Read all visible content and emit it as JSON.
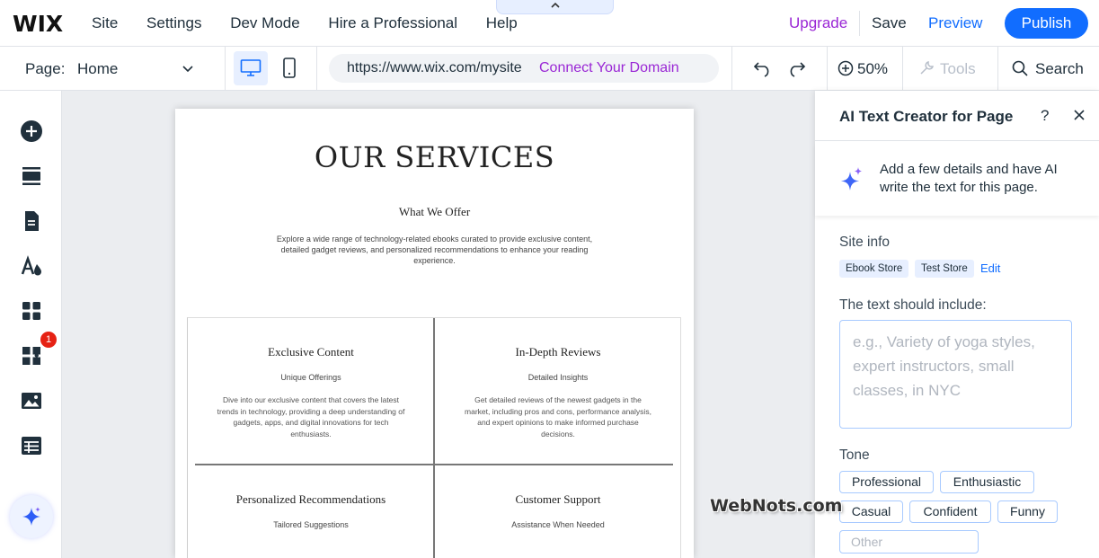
{
  "topbar": {
    "logo": "WIX",
    "nav": [
      "Site",
      "Settings",
      "Dev Mode",
      "Hire a Professional",
      "Help"
    ],
    "upgrade": "Upgrade",
    "save": "Save",
    "preview": "Preview",
    "publish": "Publish",
    "collapse_icon": "chevron-up-icon"
  },
  "secondbar": {
    "page_label": "Page:",
    "page_value": "Home",
    "url": "https://www.wix.com/mysite",
    "connect_domain": "Connect Your Domain",
    "zoom": "50%",
    "tools": "Tools",
    "search": "Search"
  },
  "sidebar": {
    "icons": [
      "add-elements-icon",
      "sections-icon",
      "pages-icon",
      "design-icon",
      "apps-icon",
      "business-apps-icon",
      "media-icon",
      "cms-icon",
      "ai-assistant-icon"
    ],
    "badge": "1"
  },
  "canvas": {
    "title": "OUR SERVICES",
    "subtitle": "What We Offer",
    "description": "Explore a wide range of technology-related ebooks curated to provide exclusive content, detailed gadget reviews, and personalized recommendations to enhance your reading experience.",
    "cells": [
      {
        "title": "Exclusive Content",
        "sub": "Unique Offerings",
        "desc": "Dive into our exclusive content that covers the latest trends in technology, providing a deep understanding of gadgets, apps, and digital innovations for tech enthusiasts."
      },
      {
        "title": "In-Depth Reviews",
        "sub": "Detailed Insights",
        "desc": "Get detailed reviews of the newest gadgets in the market, including pros and cons, performance analysis, and expert opinions to make informed purchase decisions."
      },
      {
        "title": "Personalized Recommendations",
        "sub": "Tailored Suggestions",
        "desc": ""
      },
      {
        "title": "Customer Support",
        "sub": "Assistance When Needed",
        "desc": ""
      }
    ]
  },
  "panel": {
    "title": "AI Text Creator for Page",
    "help": "?",
    "intro": "Add a few details and have AI write the text for this page.",
    "site_info_label": "Site info",
    "chips": [
      "Ebook Store",
      "Test Store"
    ],
    "edit": "Edit",
    "include_label": "The text should include:",
    "include_placeholder": "e.g., Variety of yoga styles, expert instructors, small classes, in NYC",
    "tone_label": "Tone",
    "tones": [
      "Professional",
      "Enthusiastic",
      "Casual",
      "Confident",
      "Funny"
    ],
    "other_placeholder": "Other"
  },
  "watermark": "WebNots.com",
  "colors": {
    "accent": "#116dff",
    "upgrade": "#9a27d5",
    "badge": "#e62214",
    "canvas_bg": "#ebedf0"
  }
}
